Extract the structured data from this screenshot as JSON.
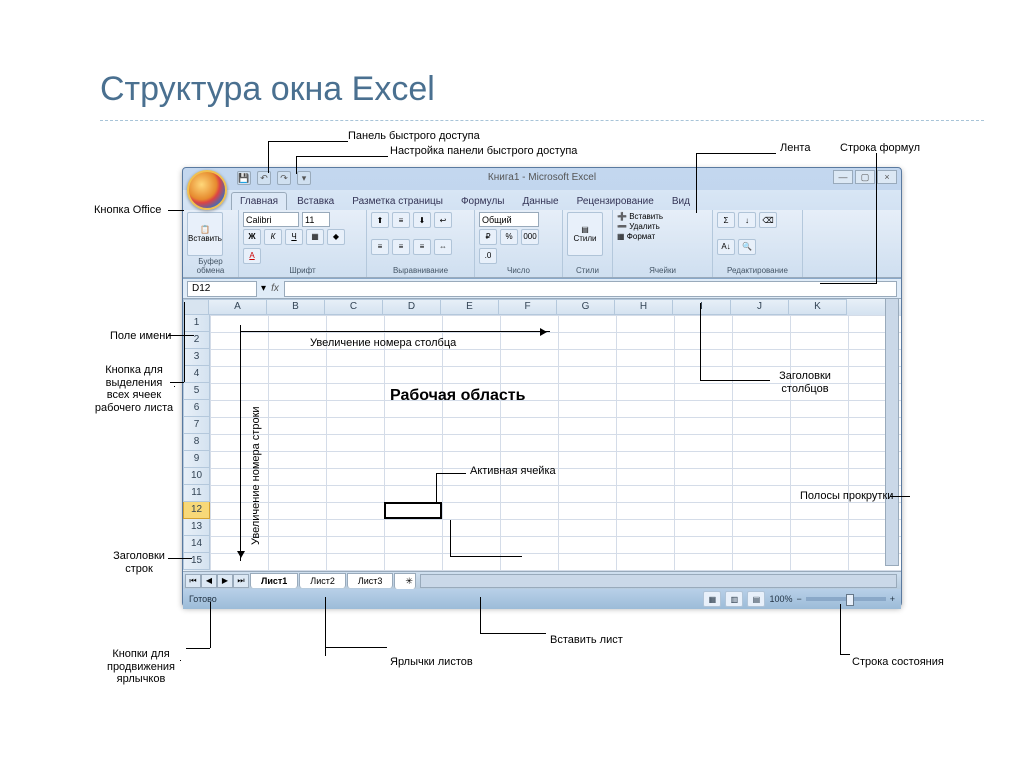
{
  "slide": {
    "title": "Структура окна Excel"
  },
  "callouts": {
    "quick_access": "Панель быстрого доступа",
    "customize_qa": "Настройка панели быстрого доступа",
    "ribbon": "Лента",
    "formula_bar": "Строка формул",
    "office_button": "Кнопка Office",
    "name_box": "Поле имени",
    "select_all": "Кнопка для выделения всех ячеек рабочего листа",
    "row_headers": "Заголовки строк",
    "nav_buttons": "Кнопки для продвижения ярлычков",
    "sheet_tabs": "Ярлычки листов",
    "insert_sheet": "Вставить лист",
    "status_bar": "Строка состояния",
    "scrollbars": "Полосы прокрутки",
    "col_headers": "Заголовки столбцов",
    "work_area": "Рабочая область",
    "active_cell": "Активная ячейка",
    "col_increase": "Увеличение номера столбца",
    "row_increase": "Увеличение номера строки"
  },
  "excel": {
    "title": "Книга1 - Microsoft Excel",
    "tabs": [
      "Главная",
      "Вставка",
      "Разметка страницы",
      "Формулы",
      "Данные",
      "Рецензирование",
      "Вид"
    ],
    "groups": {
      "clipboard": "Буфер обмена",
      "font": "Шрифт",
      "align": "Выравнивание",
      "number": "Число",
      "styles": "Стили",
      "cells": "Ячейки",
      "editing": "Редактирование",
      "paste": "Вставить",
      "font_name": "Calibri",
      "font_size": "11",
      "number_fmt": "Общий",
      "insert": "Вставить",
      "delete": "Удалить",
      "format": "Формат"
    },
    "name_box": "D12",
    "columns": [
      "A",
      "B",
      "C",
      "D",
      "E",
      "F",
      "G",
      "H",
      "I",
      "J",
      "K"
    ],
    "rows": [
      "1",
      "2",
      "3",
      "4",
      "5",
      "6",
      "7",
      "8",
      "9",
      "10",
      "11",
      "12",
      "13",
      "14",
      "15"
    ],
    "selected_row": "12",
    "sheet_tabs": [
      "Лист1",
      "Лист2",
      "Лист3"
    ],
    "status": "Готово",
    "zoom": "100%"
  }
}
